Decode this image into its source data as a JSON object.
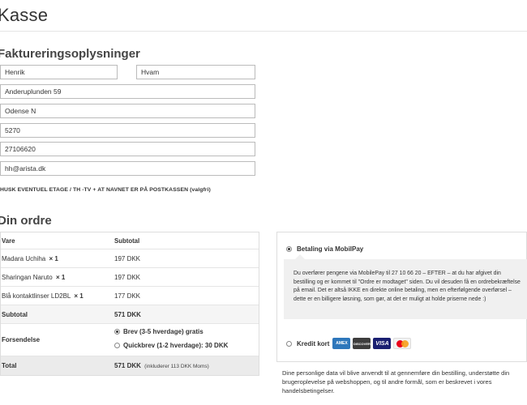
{
  "page": {
    "title": "Kasse"
  },
  "billing": {
    "heading": "Faktureringsoplysninger",
    "first_name": "Henrik",
    "last_name": "Hvam",
    "address": "Anderuplunden 59",
    "city": "Odense N",
    "postcode": "5270",
    "phone": "27106620",
    "email": "hh@arista.dk",
    "note": "HUSK EVENTUEL ETAGE / TH -TV + AT NAVNET ER PÅ POSTKASSEN (valgfri)"
  },
  "order": {
    "heading": "Din ordre",
    "col_product": "Vare",
    "col_subtotal": "Subtotal",
    "items": [
      {
        "name": "Madara Uchiha",
        "qty": "× 1",
        "price": "197 DKK"
      },
      {
        "name": "Sharingan Naruto",
        "qty": "× 1",
        "price": "197 DKK"
      },
      {
        "name": "Blå kontaktlinser LD2BL",
        "qty": "× 1",
        "price": "177 DKK"
      }
    ],
    "subtotal_label": "Subtotal",
    "subtotal_value": "571 DKK",
    "shipping_label": "Forsendelse",
    "shipping_options": [
      {
        "label": "Brev (3-5 hverdage) gratis",
        "selected": true
      },
      {
        "label": "Quickbrev (1-2 hverdage): 30 DKK",
        "selected": false
      }
    ],
    "total_label": "Total",
    "total_value": "571 DKK",
    "total_note": "(inkluderer 113 DKK Moms)"
  },
  "payment": {
    "mobilepay_label": "Betaling via MobilPay",
    "mobilepay_selected": true,
    "mobilepay_description": "Du overfører pengene via MobilePay til 27 10 66 20 – EFTER – at du har afgivet din bestilling og er kommet til \"Ordre er modtaget\" siden. Du vil desuden få en ordrebekræftelse på email. Det er altså IKKE en direkte online betaling, men en efterfølgende overførsel – dette er en billigere løsning, som gør, at det er muligt at holde priserne nede :)",
    "card_label": "Kredit kort",
    "card_selected": false,
    "card_logos": [
      "AMEX",
      "DISCOVER",
      "VISA"
    ]
  },
  "privacy_text": "Dine personlige data vil blive anvendt til at gennemføre din bestilling, understøtte din brugeroplevelse på webshoppen, og til andre formål, som er beskrevet i vores handelsbetingelser.",
  "colors": {
    "amex": "#2e77bb",
    "visa": "#1a1f71",
    "mastercard_red": "#eb001b",
    "mastercard_yellow": "#f79e1b",
    "total_row_bg": "#ebebeb"
  }
}
